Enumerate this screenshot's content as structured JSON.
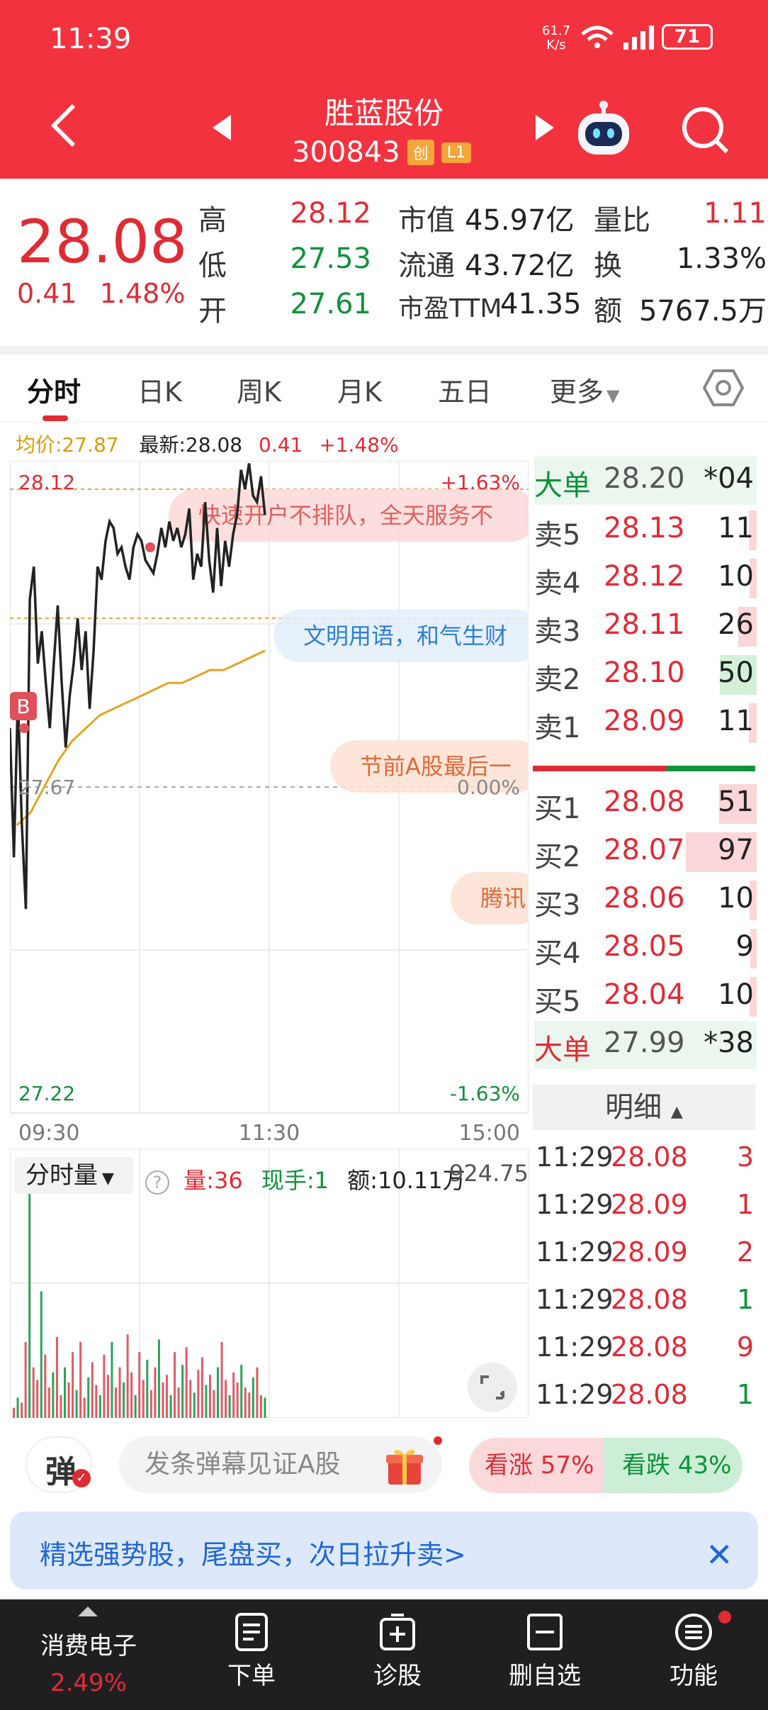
{
  "status_bar": {
    "time": "11:39",
    "speed_value": "61.7",
    "speed_unit": "K/s",
    "battery": "71"
  },
  "header": {
    "name": "胜蓝股份",
    "code": "300843",
    "tag1": "创",
    "tag2": "L1"
  },
  "quote": {
    "price": "28.08",
    "change": "0.41",
    "change_pct": "1.48%",
    "rows": [
      {
        "l1": "高",
        "v1": "28.12",
        "c1": "red",
        "l2": "市值",
        "v2": "45.97亿",
        "l3": "量比",
        "v3": "1.11",
        "c3": "red"
      },
      {
        "l1": "低",
        "v1": "27.53",
        "c1": "green",
        "l2": "流通",
        "v2": "43.72亿",
        "l3": "换",
        "v3": "1.33%",
        "c3": "dark"
      },
      {
        "l1": "开",
        "v1": "27.61",
        "c1": "green",
        "l2": "市盈TTM",
        "v2": "41.35",
        "l3": "额",
        "v3": "5767.5万",
        "c3": "dark"
      }
    ]
  },
  "tabs": [
    "分时",
    "日K",
    "周K",
    "月K",
    "五日",
    "更多"
  ],
  "info_line": {
    "avg": "均价:27.87",
    "latest": "最新:28.08",
    "chg": "0.41",
    "pct": "+1.48%"
  },
  "chart_data": {
    "type": "line",
    "high_label": "28.12",
    "low_label": "27.22",
    "mid_label": "27.67",
    "pct_high": "+1.63%",
    "pct_mid": "0.00%",
    "pct_low": "-1.63%",
    "x_ticks": [
      "09:30",
      "11:30",
      "15:00"
    ],
    "ylim": [
      27.22,
      28.12
    ],
    "series": [
      {
        "name": "最新",
        "values": [
          27.75,
          27.55,
          27.8,
          27.6,
          27.47,
          27.95,
          28.0,
          27.85,
          27.9,
          27.82,
          27.75,
          27.85,
          27.94,
          27.82,
          27.72,
          27.8,
          27.85,
          27.92,
          27.84,
          27.9,
          27.78,
          27.87,
          28.0,
          27.98,
          28.04,
          28.07,
          28.06,
          28.02,
          28.03,
          28.0,
          27.98,
          28.03,
          28.05,
          28.04,
          28.01,
          28.0,
          27.99,
          28.02,
          28.06,
          28.03,
          28.07,
          28.04,
          28.06,
          28.03,
          28.05,
          28.09,
          27.98,
          28.02,
          28.0,
          28.1,
          28.01,
          27.96,
          28.06,
          27.97,
          28.04,
          28.0,
          28.05,
          28.08,
          28.15,
          28.12,
          28.16,
          28.11,
          28.1,
          28.14,
          28.08
        ]
      },
      {
        "name": "均价",
        "values": [
          27.6,
          27.62,
          27.66,
          27.7,
          27.73,
          27.75,
          27.77,
          27.78,
          27.79,
          27.8,
          27.81,
          27.82,
          27.82,
          27.83,
          27.84,
          27.84,
          27.85,
          27.86,
          27.87
        ]
      }
    ],
    "volume": {
      "max_label": "924.75",
      "values": [
        40,
        80,
        60,
        300,
        900,
        200,
        150,
        500,
        250,
        120,
        180,
        320,
        90,
        200,
        140,
        260,
        110,
        300,
        80,
        160,
        220,
        130,
        90,
        250,
        170,
        300,
        120,
        200,
        140,
        330,
        180,
        90,
        260,
        150,
        230,
        110,
        200,
        310,
        140,
        170,
        90,
        260,
        120,
        210,
        280,
        150,
        100,
        190,
        240,
        130,
        170,
        110,
        200,
        300,
        150,
        90,
        180,
        140,
        210,
        120,
        100,
        160,
        200,
        90,
        80
      ]
    }
  },
  "overlays": [
    "快速开户不排队，全天服务不",
    "文明用语，和气生财",
    "节前A股最后一",
    "腾讯"
  ],
  "orderbook": {
    "big_top": {
      "label": "大单",
      "price": "28.20",
      "vol": "*04"
    },
    "asks": [
      {
        "label": "卖5",
        "price": "28.13",
        "vol": "11",
        "bar": 0.11
      },
      {
        "label": "卖4",
        "price": "28.12",
        "vol": "10",
        "bar": 0.1
      },
      {
        "label": "卖3",
        "price": "28.11",
        "vol": "26",
        "bar": 0.26
      },
      {
        "label": "卖2",
        "price": "28.10",
        "vol": "50",
        "bar": 0.52
      },
      {
        "label": "卖1",
        "price": "28.09",
        "vol": "11",
        "bar": 0.11
      }
    ],
    "bids": [
      {
        "label": "买1",
        "price": "28.08",
        "vol": "51",
        "bar": 0.53
      },
      {
        "label": "买2",
        "price": "28.07",
        "vol": "97",
        "bar": 1.0
      },
      {
        "label": "买3",
        "price": "28.06",
        "vol": "10",
        "bar": 0.1
      },
      {
        "label": "买4",
        "price": "28.05",
        "vol": "9",
        "bar": 0.09
      },
      {
        "label": "买5",
        "price": "28.04",
        "vol": "10",
        "bar": 0.1
      }
    ],
    "big_bottom": {
      "label": "大单",
      "price": "27.99",
      "vol": "*38"
    }
  },
  "detail": {
    "title": "明细",
    "rows": [
      {
        "t": "11:29",
        "p": "28.08",
        "v": "3",
        "c": "red"
      },
      {
        "t": "11:29",
        "p": "28.09",
        "v": "1",
        "c": "red"
      },
      {
        "t": "11:29",
        "p": "28.09",
        "v": "2",
        "c": "red"
      },
      {
        "t": "11:29",
        "p": "28.08",
        "v": "1",
        "c": "green"
      },
      {
        "t": "11:29",
        "p": "28.08",
        "v": "9",
        "c": "red"
      },
      {
        "t": "11:29",
        "p": "28.08",
        "v": "1",
        "c": "green"
      }
    ]
  },
  "volume_panel": {
    "selector": "分时量",
    "vol": "量:36",
    "hand": "现手:1",
    "amount": "额:10.11万"
  },
  "danmu": {
    "icon": "弹",
    "placeholder": "发条弹幕见证A股",
    "bull": "看涨 57%",
    "bear": "看跌 43%"
  },
  "promo": {
    "text": "精选强势股，尾盘买，次日拉升卖>"
  },
  "bottom_nav": [
    {
      "label": "消费电子",
      "sub": "2.49%"
    },
    {
      "label": "下单"
    },
    {
      "label": "诊股"
    },
    {
      "label": "删自选"
    },
    {
      "label": "功能"
    }
  ]
}
